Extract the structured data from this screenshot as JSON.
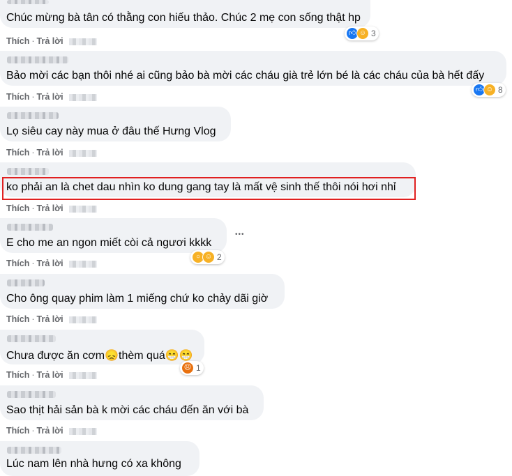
{
  "comments": [
    {
      "text": "Chúc mừng bà tân có thằng con hiếu thảo. Chúc 2 mẹ con sống thật hp",
      "like": "Thích",
      "reply": "Trả lời",
      "reactions": {
        "icons": [
          "like-icon",
          "haha-icon"
        ],
        "count": "3"
      }
    },
    {
      "text": "Bảo mời các bạn thôi nhé ai cũng bảo bà mời các cháu già trẻ lớn bé là các cháu của bà hết đấy",
      "like": "Thích",
      "reply": "Trả lời",
      "reactions": {
        "icons": [
          "like-icon",
          "haha-icon"
        ],
        "count": "8"
      }
    },
    {
      "text": "Lọ siêu cay này mua ở đâu thế Hưng Vlog",
      "like": "Thích",
      "reply": "Trả lời"
    },
    {
      "text": "ko phải an là chet dau nhìn ko dung gang tay là mất vệ sinh thế thôi nói hơi nhỉ",
      "like": "Thích",
      "reply": "Trả lời",
      "highlighted": true
    },
    {
      "text": "E cho me an ngon miết còi cả ngươi kkkk",
      "like": "Thích",
      "reply": "Trả lời",
      "reactions": {
        "icons": [
          "wow-icon",
          "haha-icon"
        ],
        "count": "2"
      },
      "more": "•••"
    },
    {
      "text": "Cho ông quay phim làm 1 miếng chứ ko chảy dãi giờ",
      "like": "Thích",
      "reply": "Trả lời"
    },
    {
      "text": "Chưa được ăn cơm😞thèm quá😁😁",
      "like": "Thích",
      "reply": "Trả lời",
      "reactions": {
        "icons": [
          "angry-icon"
        ],
        "count": "1"
      }
    },
    {
      "text": "Sao thịt hải sản bà k mời các cháu đến ăn với bà",
      "like": "Thích",
      "reply": "Trả lời"
    },
    {
      "text": "Lúc nam lên nhà hưng có xa không",
      "like": "Thích",
      "reply": "Trả lời"
    }
  ],
  "separator": "·",
  "colors": {
    "bubble": "#f0f2f5",
    "highlight": "#e02020",
    "like": "#1877f2"
  }
}
